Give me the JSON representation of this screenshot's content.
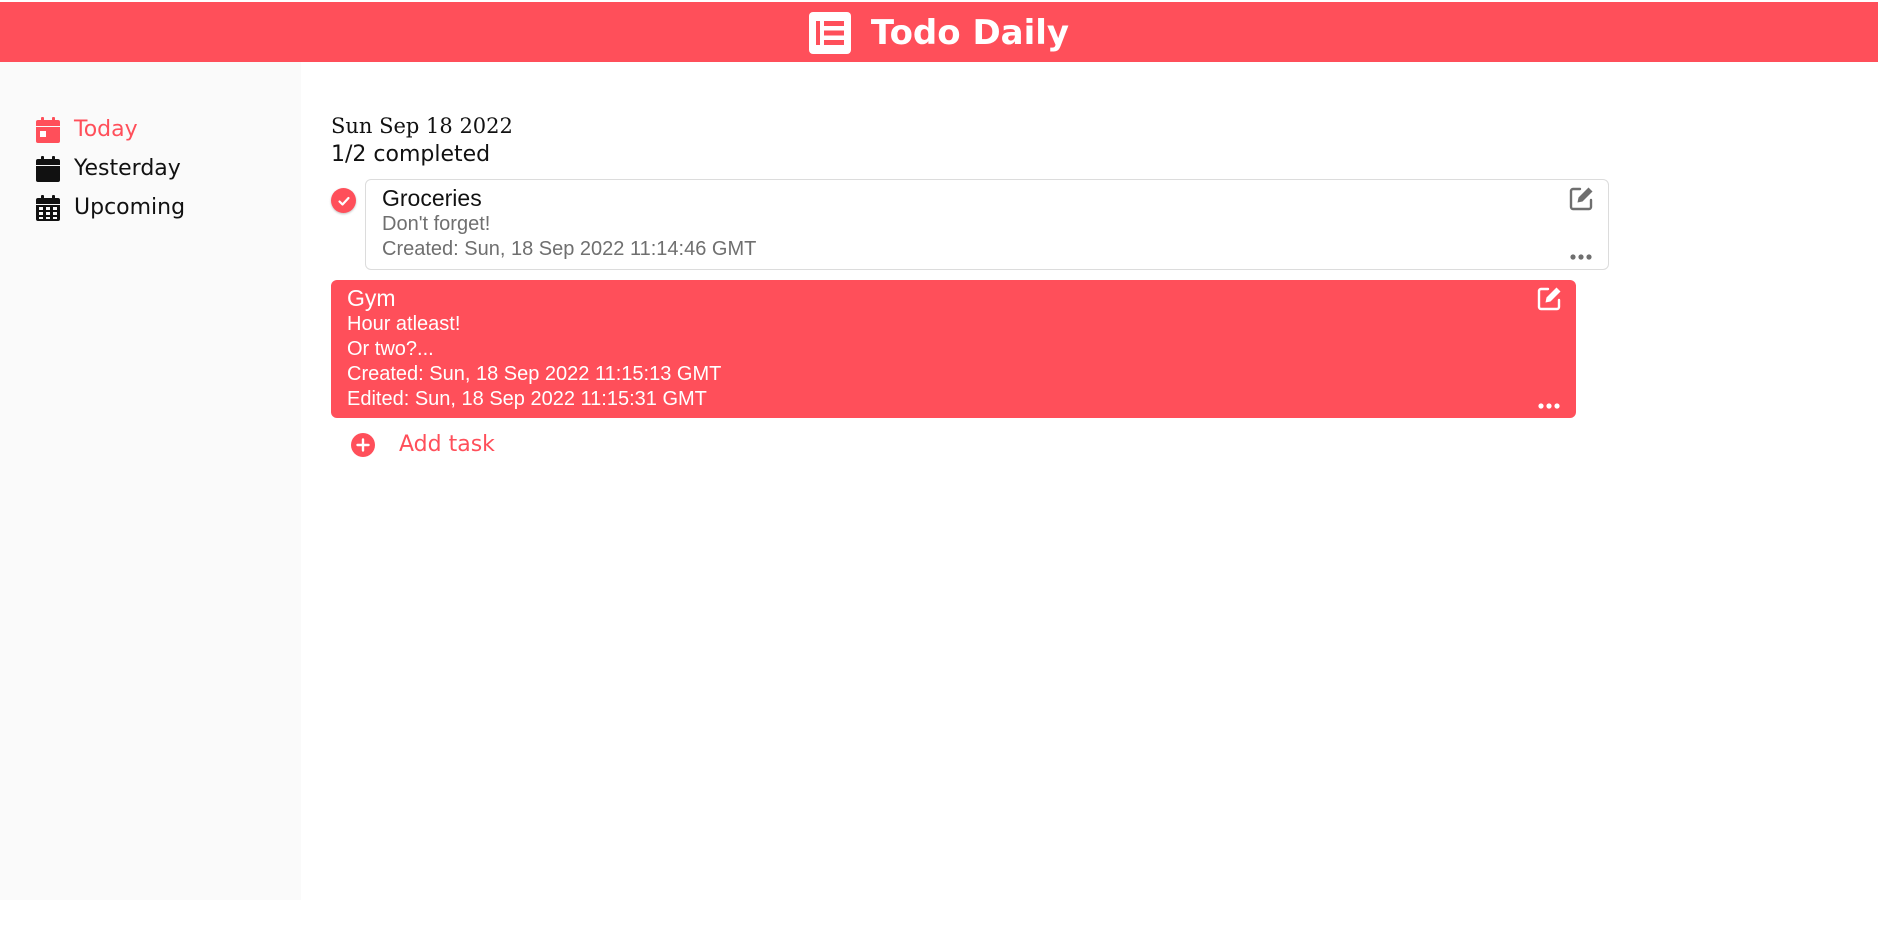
{
  "header": {
    "app_title": "Todo Daily",
    "brand_color": "#ff4f5a",
    "icon": "list-icon"
  },
  "sidebar": {
    "items": [
      {
        "label": "Today",
        "icon": "calendar-day-icon",
        "active": true
      },
      {
        "label": "Yesterday",
        "icon": "calendar-icon",
        "active": false
      },
      {
        "label": "Upcoming",
        "icon": "calendar-grid-icon",
        "active": false
      }
    ]
  },
  "main": {
    "date": "Sun Sep 18 2022",
    "progress": "1/2 completed",
    "tasks": [
      {
        "title": "Groceries",
        "lines": [
          "Don't forget!"
        ],
        "created": "Created: Sun, 18 Sep 2022 11:14:46 GMT",
        "completed": true
      },
      {
        "title": "Gym",
        "lines": [
          "Hour atleast!",
          "Or two?..."
        ],
        "created": "Created: Sun, 18 Sep 2022 11:15:13 GMT",
        "edited": "Edited: Sun, 18 Sep 2022 11:15:31 GMT",
        "completed": false
      }
    ],
    "add_task_label": "Add task"
  }
}
